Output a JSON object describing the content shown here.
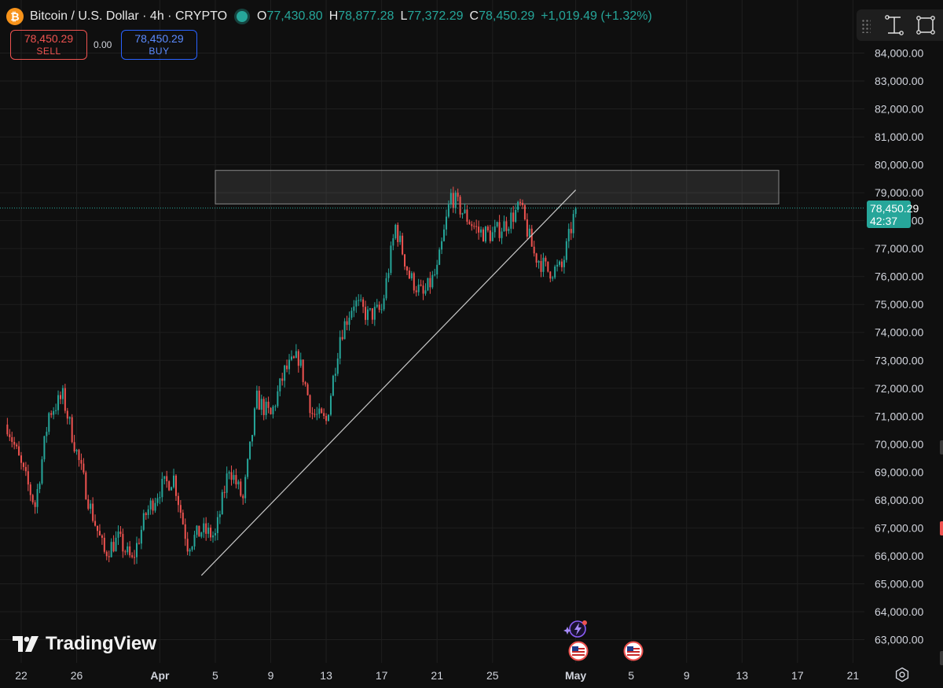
{
  "header": {
    "symbol": "Bitcoin / U.S. Dollar · 4h · CRYPTO",
    "coin_glyph": "₿",
    "open_label": "O",
    "open": "77,430.80",
    "high_label": "H",
    "high": "78,877.28",
    "low_label": "L",
    "low": "77,372.29",
    "close_label": "C",
    "close": "78,450.29",
    "change": "+1,019.49 (+1.32%)"
  },
  "trade": {
    "sell_price": "78,450.29",
    "sell_label": "SELL",
    "spread": "0.00",
    "buy_price": "78,450.29",
    "buy_label": "BUY"
  },
  "last_price": {
    "price": "78,450.29",
    "countdown": "42:37"
  },
  "branding": {
    "logo_text": "TradingView"
  },
  "icons": [
    "drag-handle-icon",
    "cursor-text-icon",
    "fullscreen-icon",
    "settings-gear-icon",
    "tradingview-logo-icon",
    "us-flag-icon",
    "lightning-event-icon"
  ],
  "colors": {
    "background": "#0f0f0f",
    "up": "#26a69a",
    "down": "#ef5350",
    "grid": "#1f1f1f",
    "zone": "#3a3a3a",
    "trendline": "#c8c8c8",
    "buy_border": "#2962ff"
  },
  "chart_data": {
    "type": "candlestick",
    "title": "Bitcoin / U.S. Dollar · 4h · CRYPTO",
    "y_ticks": [
      "84,000.00",
      "83,000.00",
      "82,000.00",
      "81,000.00",
      "80,000.00",
      "79,000.00",
      "78,000.00",
      "77,000.00",
      "76,000.00",
      "75,000.00",
      "74,000.00",
      "73,000.00",
      "72,000.00",
      "71,000.00",
      "70,000.00",
      "69,000.00",
      "68,000.00",
      "67,000.00",
      "66,000.00",
      "65,000.00",
      "64,000.00",
      "63,000.00"
    ],
    "x_ticks": [
      "22",
      "26",
      "Apr",
      "5",
      "9",
      "13",
      "17",
      "21",
      "25",
      "May",
      "5",
      "9",
      "13",
      "17",
      "21"
    ],
    "ylim": [
      62600,
      84700
    ],
    "grid": true,
    "price_path": [
      {
        "d": "Mar 21",
        "p": 70700
      },
      {
        "d": "Mar 22",
        "p": 69200
      },
      {
        "d": "Mar 23",
        "p": 67800
      },
      {
        "d": "Mar 24",
        "p": 71100
      },
      {
        "d": "Mar 25",
        "p": 71700
      },
      {
        "d": "Mar 26",
        "p": 69700
      },
      {
        "d": "Mar 27",
        "p": 67700
      },
      {
        "d": "Mar 28",
        "p": 66100
      },
      {
        "d": "Mar 29",
        "p": 66600
      },
      {
        "d": "Mar 30",
        "p": 65800
      },
      {
        "d": "Mar 31",
        "p": 67500
      },
      {
        "d": "Apr 1",
        "p": 68400
      },
      {
        "d": "Apr 2",
        "p": 68800
      },
      {
        "d": "Apr 3",
        "p": 66400
      },
      {
        "d": "Apr 4",
        "p": 66900
      },
      {
        "d": "Apr 5",
        "p": 66700
      },
      {
        "d": "Apr 6",
        "p": 69200
      },
      {
        "d": "Apr 7",
        "p": 68000
      },
      {
        "d": "Apr 8",
        "p": 71600
      },
      {
        "d": "Apr 9",
        "p": 71000
      },
      {
        "d": "Apr 10",
        "p": 72600
      },
      {
        "d": "Apr 11",
        "p": 73100
      },
      {
        "d": "Apr 12",
        "p": 71100
      },
      {
        "d": "Apr 13",
        "p": 70800
      },
      {
        "d": "Apr 14",
        "p": 73900
      },
      {
        "d": "Apr 15",
        "p": 75100
      },
      {
        "d": "Apr 16",
        "p": 74600
      },
      {
        "d": "Apr 17",
        "p": 74800
      },
      {
        "d": "Apr 18",
        "p": 77800
      },
      {
        "d": "Apr 19",
        "p": 76000
      },
      {
        "d": "Apr 20",
        "p": 75300
      },
      {
        "d": "Apr 21",
        "p": 76200
      },
      {
        "d": "Apr 22",
        "p": 78900
      },
      {
        "d": "Apr 23",
        "p": 78200
      },
      {
        "d": "Apr 24",
        "p": 77600
      },
      {
        "d": "Apr 25",
        "p": 77500
      },
      {
        "d": "Apr 26",
        "p": 77900
      },
      {
        "d": "Apr 27",
        "p": 78500
      },
      {
        "d": "Apr 28",
        "p": 76800
      },
      {
        "d": "Apr 29",
        "p": 76200
      },
      {
        "d": "Apr 30",
        "p": 76300
      },
      {
        "d": "May 1",
        "p": 78450
      }
    ],
    "current_price": 78450.29,
    "resistance_zone": [
      78600,
      79800
    ],
    "trendline": {
      "from": {
        "d": "Apr 4",
        "p": 65300
      },
      "to": {
        "d": "May 1",
        "p": 79100
      }
    }
  }
}
